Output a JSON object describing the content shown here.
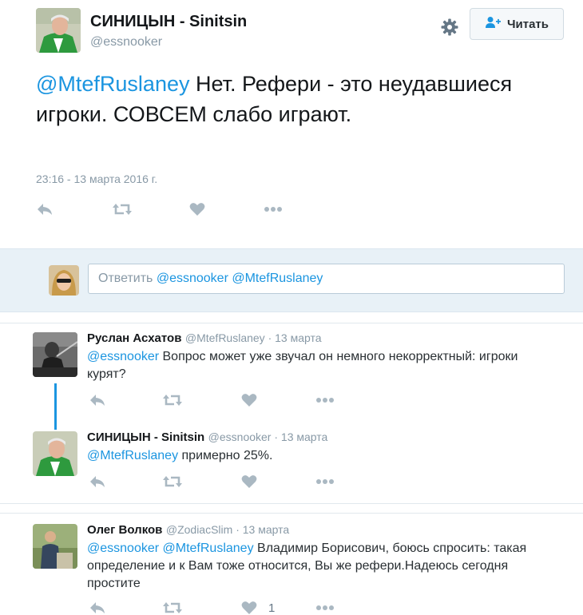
{
  "main_tweet": {
    "name": "СИНИЦЫН - Sinitsin",
    "handle": "@essnooker",
    "follow_label": "Читать",
    "mention": "@MtefRuslaney",
    "text": " Нет. Рефери - это неудавшиеся игроки. СОВСЕМ слабо играют.",
    "date": "23:16 - 13 марта 2016 г."
  },
  "reply_box": {
    "prefix": "Ответить ",
    "mentions": "@essnooker @MtefRuslaney"
  },
  "replies": [
    {
      "name": "Руслан Асхатов",
      "handle": "@MtefRuslaney",
      "sep": " · ",
      "date": "13 марта",
      "mentions": "@essnooker",
      "text": " Вопрос может уже звучал он немного некорректный: игроки курят?"
    },
    {
      "name": "СИНИЦЫН - Sinitsin",
      "handle": "@essnooker",
      "sep": " · ",
      "date": "13 марта",
      "mentions": "@MtefRuslaney",
      "text": " примерно 25%."
    },
    {
      "name": "Олег Волков",
      "handle": "@ZodiacSlim",
      "sep": " · ",
      "date": "13 марта",
      "mentions": "@essnooker @MtefRuslaney",
      "text": " Владимир Борисович, боюсь спросить: такая определение и к Вам тоже относится, Вы же рефери.Надеюсь сегодня простите",
      "like_count": "1"
    }
  ],
  "icons": {
    "reply": "reply-icon",
    "retweet": "retweet-icon",
    "like": "heart-icon",
    "more": "more-icon",
    "settings": "gear-icon",
    "follow": "add-user-icon"
  },
  "colors": {
    "link": "#1b95e0",
    "muted": "#8899a6",
    "reply_bg": "#e8f1f7"
  }
}
